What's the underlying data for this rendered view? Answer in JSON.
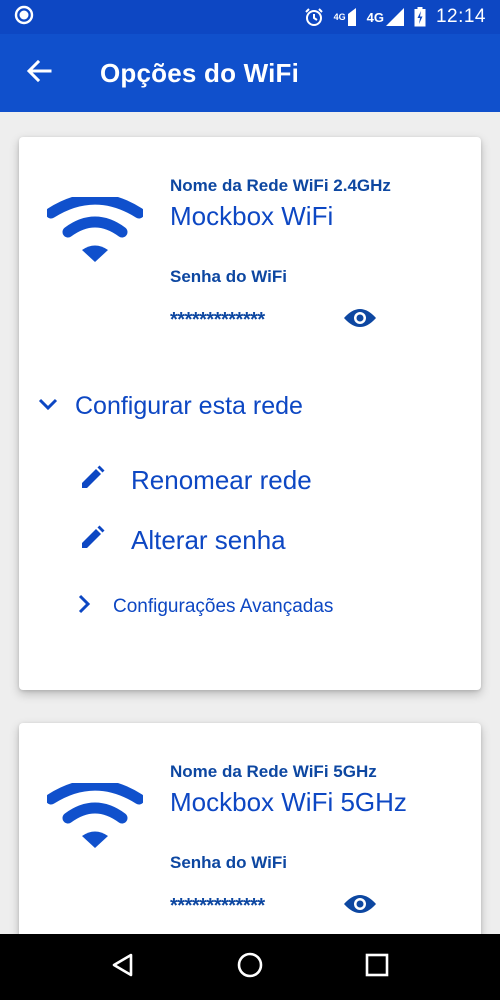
{
  "status_bar": {
    "time": "12:14",
    "network_4g_small": "4G",
    "network_4g": "4G"
  },
  "app_bar": {
    "title": "Opções do WiFi"
  },
  "cards": [
    {
      "network_label": "Nome da Rede WiFi 2.4GHz",
      "network_name": "Mockbox WiFi",
      "password_label": "Senha do WiFi",
      "password_value": "*************",
      "configure_label": "Configurar esta rede",
      "rename_label": "Renomear rede",
      "change_password_label": "Alterar senha",
      "advanced_label": "Configurações Avançadas"
    },
    {
      "network_label": "Nome da Rede WiFi 5GHz",
      "network_name": "Mockbox WiFi 5GHz",
      "password_label": "Senha do WiFi",
      "password_value": "*************"
    }
  ],
  "icons": {
    "back": "arrow-back-icon",
    "wifi": "wifi-icon",
    "eye": "eye-icon",
    "chevron_down": "chevron-down-icon",
    "pencil": "pencil-icon",
    "chevron_right": "chevron-right-icon"
  },
  "colors": {
    "primary": "#1050cc",
    "status_bar": "#0d47c3",
    "text_blue": "#0d47c3",
    "background": "#eeeeee"
  }
}
